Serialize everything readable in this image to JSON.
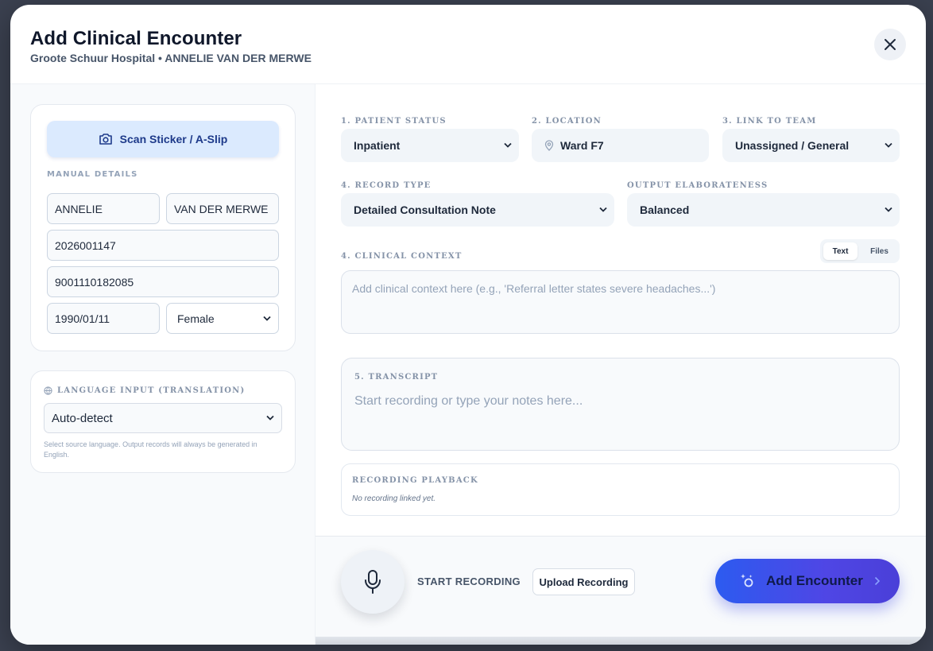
{
  "header": {
    "title": "Add Clinical Encounter",
    "hospital": "Groote Schuur Hospital",
    "separator": "•",
    "patient_name": "ANNELIE VAN DER MERWE",
    "close_icon": "close-icon"
  },
  "patient_card": {
    "scan_button_label": "Scan Sticker / A-Slip",
    "scan_icon": "camera-icon",
    "manual_details_label": "MANUAL DETAILS",
    "first_name": "ANNELIE",
    "last_name": "VAN DER MERWE",
    "folder_number": "2026001147",
    "id_number": "9001110182085",
    "dob": "1990/01/11",
    "sex": "Female"
  },
  "language_card": {
    "label": "LANGUAGE INPUT (TRANSLATION)",
    "icon": "globe-icon",
    "selected": "Auto-detect",
    "note": "Select source language. Output records will always be generated in English."
  },
  "form": {
    "patient_status_label": "1. PATIENT STATUS",
    "patient_status_value": "Inpatient",
    "location_label": "2. LOCATION",
    "location_value": "Ward F7",
    "location_icon": "map-pin-icon",
    "team_label": "3. LINK TO TEAM",
    "team_value": "Unassigned / General",
    "record_type_label": "4. RECORD TYPE",
    "record_type_value": "Detailed Consultation Note",
    "elaborateness_label": "OUTPUT ELABORATENESS",
    "elaborateness_value": "Balanced",
    "context_label": "4. CLINICAL CONTEXT",
    "context_tabs": [
      "Text",
      "Files"
    ],
    "context_placeholder": "Add clinical context here (e.g., 'Referral letter states severe headaches...')",
    "transcript_label": "5. TRANSCRIPT",
    "transcript_placeholder": "Start recording or type your notes here...",
    "playback_label": "RECORDING PLAYBACK",
    "playback_empty": "No recording linked yet."
  },
  "footer": {
    "mic_icon": "microphone-icon",
    "start_recording_label": "START RECORDING",
    "upload_label": "Upload Recording",
    "add_label": "Add Encounter",
    "add_icon": "sparkles-icon",
    "chevron_icon": "chevron-right-icon"
  },
  "colors": {
    "accent": "#2c5bf0",
    "accent_end": "#4a3fd8",
    "scan_bg": "#dbeafe",
    "scan_text": "#1e3a8a"
  }
}
